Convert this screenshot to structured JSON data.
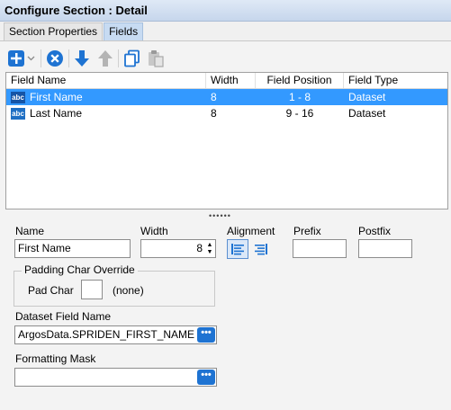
{
  "window": {
    "title": "Configure Section : Detail"
  },
  "tabs": [
    {
      "label": "Section Properties",
      "active": false
    },
    {
      "label": "Fields",
      "active": true
    }
  ],
  "toolbar": {
    "icons": [
      "add-icon",
      "dropdown-chevron-icon",
      "delete-icon",
      "move-down-icon",
      "move-up-icon",
      "copy-icon",
      "paste-icon"
    ],
    "colors": {
      "primary": "#1e73d2",
      "disabled": "#b4b4b4"
    }
  },
  "grid": {
    "columns": [
      "Field Name",
      "Width",
      "Field Position",
      "Field Type"
    ],
    "rows": [
      {
        "icon_text": "abc",
        "name": "First Name",
        "width": "8",
        "position": "1 - 8",
        "type": "Dataset",
        "selected": true
      },
      {
        "icon_text": "abc",
        "name": "Last Name",
        "width": "8",
        "position": "9 - 16",
        "type": "Dataset",
        "selected": false
      }
    ],
    "selection_color": "#3399ff"
  },
  "splitter_glyph": "••••••",
  "form": {
    "name_label": "Name",
    "name_value": "First Name",
    "width_label": "Width",
    "width_value": "8",
    "alignment_label": "Alignment",
    "prefix_label": "Prefix",
    "prefix_value": "",
    "postfix_label": "Postfix",
    "postfix_value": "",
    "padding_group_label": "Padding Char Override",
    "pad_char_label": "Pad Char",
    "pad_char_value": "",
    "pad_char_hint": "(none)",
    "dataset_field_label": "Dataset Field Name",
    "dataset_field_value": "ArgosData.SPRIDEN_FIRST_NAME",
    "formatting_mask_label": "Formatting Mask",
    "formatting_mask_value": "",
    "ellipsis_label": "•••"
  }
}
